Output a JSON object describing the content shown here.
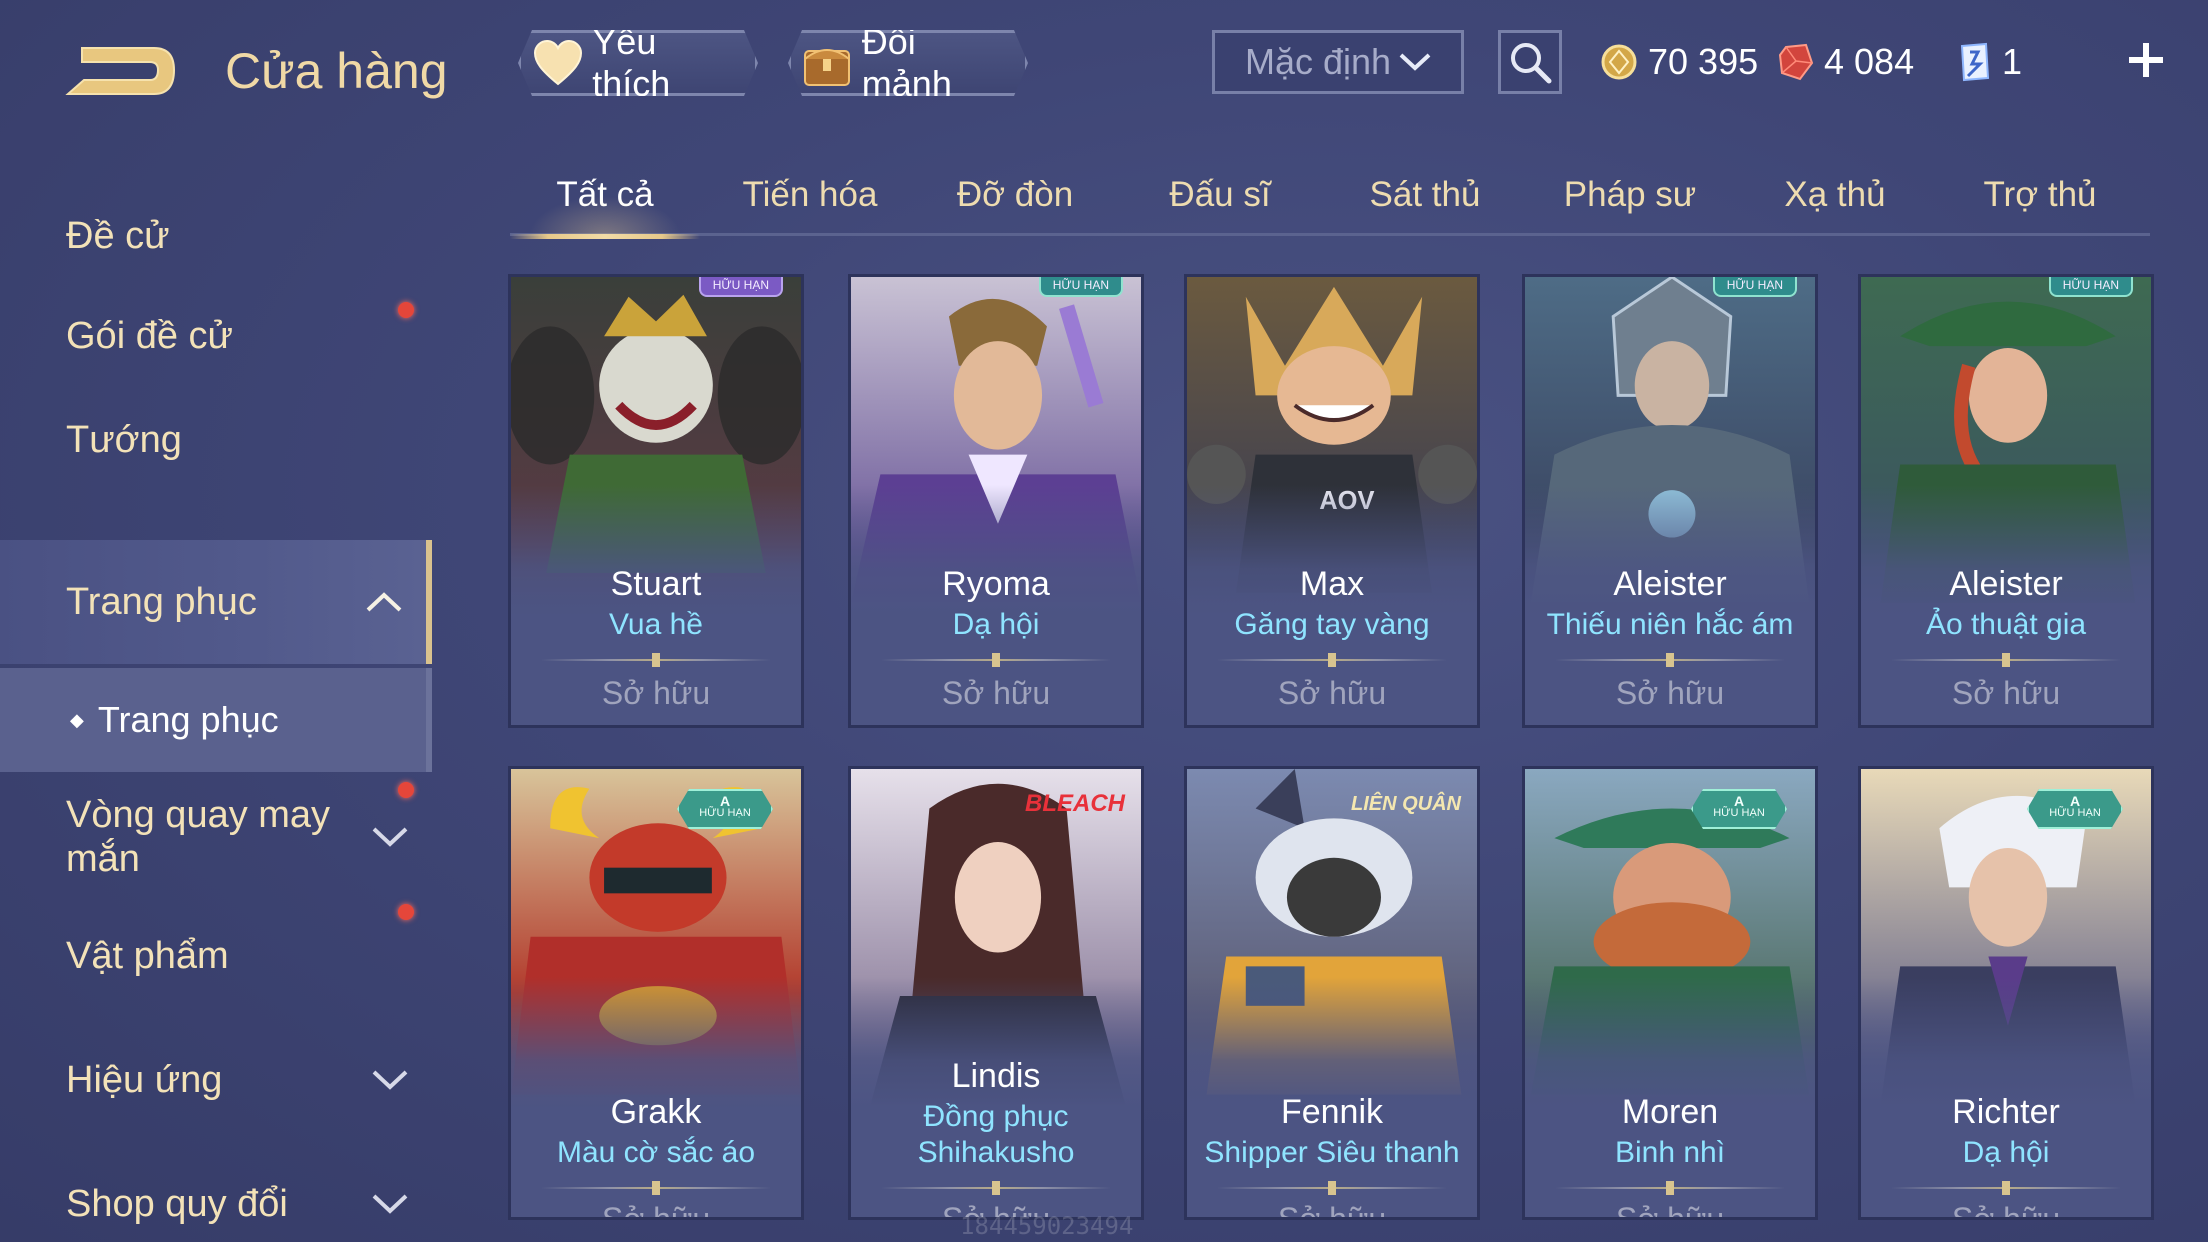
{
  "header": {
    "title": "Cửa hàng",
    "favorite_label": "Yêu thích",
    "exchange_label": "Đổi mảnh",
    "sort_value": "Mặc định",
    "gold": "70 395",
    "gems": "4 084",
    "tokens": "1"
  },
  "sidebar": {
    "items": [
      {
        "label": "Đề cử"
      },
      {
        "label": "Gói đề cử"
      },
      {
        "label": "Tướng"
      },
      {
        "label": "Trang phục"
      },
      {
        "label": "Vòng quay may mắn"
      },
      {
        "label": "Vật phẩm"
      },
      {
        "label": "Hiệu ứng"
      },
      {
        "label": "Shop quy đổi"
      }
    ],
    "sub_item": "Trang phục"
  },
  "tabs": [
    "Tất cả",
    "Tiến hóa",
    "Đỡ đòn",
    "Đấu sĩ",
    "Sát thủ",
    "Pháp sư",
    "Xạ thủ",
    "Trợ thủ"
  ],
  "cards": [
    {
      "hero": "Stuart",
      "skin": "Vua hề",
      "status": "Sở hữu",
      "badge": "HỮU HẠN"
    },
    {
      "hero": "Ryoma",
      "skin": "Dạ hội",
      "status": "Sở hữu",
      "badge": "HỮU HẠN"
    },
    {
      "hero": "Max",
      "skin": "Găng tay vàng",
      "status": "Sở hữu"
    },
    {
      "hero": "Aleister",
      "skin": "Thiếu niên hắc ám",
      "status": "Sở hữu",
      "badge": "HỮU HẠN"
    },
    {
      "hero": "Aleister",
      "skin": "Ảo thuật gia",
      "status": "Sở hữu",
      "badge": "HỮU HẠN"
    },
    {
      "hero": "Grakk",
      "skin": "Màu cờ sắc áo",
      "status": "Sở hữu",
      "badge_tier": "A",
      "badge": "HỮU HẠN"
    },
    {
      "hero": "Lindis",
      "skin": "Đồng phục Shihakusho",
      "status": "Sở hữu",
      "logo": "BLEACH"
    },
    {
      "hero": "Fennik",
      "skin": "Shipper Siêu thanh",
      "status": "Sở hữu",
      "logo": "LIÊN QUÂN"
    },
    {
      "hero": "Moren",
      "skin": "Binh nhì",
      "status": "Sở hữu",
      "badge_tier": "A",
      "badge": "HỮU HẠN"
    },
    {
      "hero": "Richter",
      "skin": "Dạ hội",
      "status": "Sở hữu",
      "badge_tier": "A",
      "badge": "HỮU HẠN"
    }
  ],
  "watermark": "184459023494",
  "colors": {
    "background": "#3f4676",
    "title_gold": "#f0d9a6",
    "skin_cyan": "#8fe4ff",
    "owned_gray": "#a0a4bd",
    "notification_red": "#e5463a"
  }
}
